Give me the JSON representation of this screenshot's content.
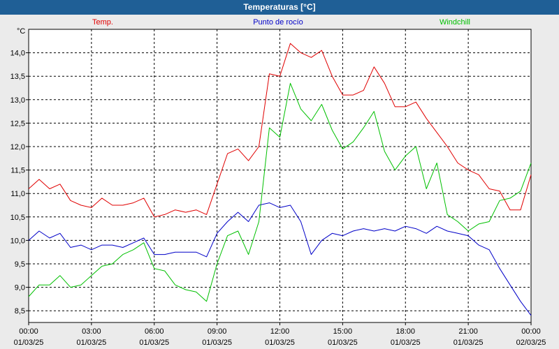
{
  "window": {
    "title": "Temperaturas [°C]"
  },
  "chart_data": {
    "type": "line",
    "title": "Temperaturas [°C]",
    "ylabel": "°C",
    "ylim": [
      8.25,
      14.5
    ],
    "xlim": [
      0,
      1440
    ],
    "grid": true,
    "y_ticks": [
      "8,5",
      "9,0",
      "9,5",
      "10,0",
      "10,5",
      "11,0",
      "11,5",
      "12,0",
      "12,5",
      "13,0",
      "13,5",
      "14,0"
    ],
    "x_ticks": [
      {
        "time": "00:00",
        "date": "01/03/25"
      },
      {
        "time": "03:00",
        "date": "01/03/25"
      },
      {
        "time": "06:00",
        "date": "01/03/25"
      },
      {
        "time": "09:00",
        "date": "01/03/25"
      },
      {
        "time": "12:00",
        "date": "01/03/25"
      },
      {
        "time": "15:00",
        "date": "01/03/25"
      },
      {
        "time": "18:00",
        "date": "01/03/25"
      },
      {
        "time": "21:00",
        "date": "01/03/25"
      },
      {
        "time": "00:00",
        "date": "02/03/25"
      }
    ],
    "x_unit": "time of day (00:00 01/03/25 to 00:00 02/03/25)",
    "x_values": [
      "00:00",
      "00:30",
      "01:00",
      "01:30",
      "02:00",
      "02:30",
      "03:00",
      "03:30",
      "04:00",
      "04:30",
      "05:00",
      "05:30",
      "06:00",
      "06:30",
      "07:00",
      "07:30",
      "08:00",
      "08:30",
      "09:00",
      "09:30",
      "10:00",
      "10:30",
      "11:00",
      "11:30",
      "12:00",
      "12:30",
      "13:00",
      "13:30",
      "14:00",
      "14:30",
      "15:00",
      "15:30",
      "16:00",
      "16:30",
      "17:00",
      "17:30",
      "18:00",
      "18:30",
      "19:00",
      "19:30",
      "20:00",
      "20:30",
      "21:00",
      "21:30",
      "22:00",
      "22:30",
      "23:00",
      "23:30",
      "00:00"
    ],
    "series": [
      {
        "name": "Temp.",
        "color": "#e00000",
        "values": [
          11.1,
          11.3,
          11.1,
          11.2,
          10.85,
          10.75,
          10.7,
          10.9,
          10.75,
          10.75,
          10.8,
          10.9,
          10.5,
          10.55,
          10.65,
          10.6,
          10.65,
          10.55,
          11.2,
          11.85,
          11.95,
          11.7,
          12.0,
          13.55,
          13.5,
          14.2,
          14.0,
          13.9,
          14.05,
          13.5,
          13.1,
          13.1,
          13.2,
          13.7,
          13.35,
          12.85,
          12.85,
          12.95,
          12.6,
          12.3,
          12.0,
          11.65,
          11.5,
          11.4,
          11.1,
          11.05,
          10.65,
          10.65,
          11.4
        ]
      },
      {
        "name": "Punto de rocío",
        "color": "#0000c8",
        "values": [
          10.0,
          10.2,
          10.05,
          10.15,
          9.85,
          9.9,
          9.8,
          9.9,
          9.9,
          9.85,
          9.95,
          10.05,
          9.7,
          9.7,
          9.75,
          9.75,
          9.75,
          9.65,
          10.15,
          10.4,
          10.6,
          10.4,
          10.75,
          10.8,
          10.7,
          10.75,
          10.4,
          9.7,
          10.0,
          10.15,
          10.1,
          10.2,
          10.25,
          10.2,
          10.25,
          10.2,
          10.3,
          10.25,
          10.15,
          10.3,
          10.2,
          10.15,
          10.1,
          9.9,
          9.8,
          9.4,
          9.05,
          8.7,
          8.4
        ]
      },
      {
        "name": "Windchill",
        "color": "#00c000",
        "values": [
          8.8,
          9.05,
          9.05,
          9.25,
          9.0,
          9.05,
          9.25,
          9.45,
          9.5,
          9.7,
          9.8,
          9.95,
          9.4,
          9.35,
          9.05,
          8.95,
          8.9,
          8.7,
          9.5,
          10.1,
          10.2,
          9.7,
          10.4,
          12.4,
          12.2,
          13.35,
          12.8,
          12.55,
          12.9,
          12.35,
          11.95,
          12.1,
          12.4,
          12.75,
          11.9,
          11.5,
          11.8,
          12.0,
          11.1,
          11.65,
          10.55,
          10.4,
          10.2,
          10.35,
          10.4,
          10.85,
          10.9,
          11.05,
          11.65
        ]
      }
    ]
  }
}
